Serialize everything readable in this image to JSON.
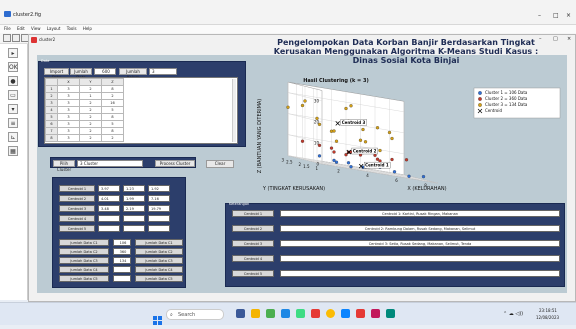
{
  "outer_window": {
    "title": "cluster2.fig"
  },
  "menu": [
    "File",
    "Edit",
    "View",
    "Layout",
    "Tools",
    "Help"
  ],
  "figure_window": {
    "title": "cluster2",
    "controls": [
      "–",
      "□",
      "×"
    ]
  },
  "data_panel": {
    "label": "Data",
    "import_button": "Import Data",
    "jumlah_data_label": "Jumlah Data",
    "jumlah_data_value": "600",
    "jumlah_kolom_label": "Jumlah Kolom",
    "jumlah_kolom_value": "3",
    "columns": [
      "X",
      "Y",
      "Z"
    ],
    "rows": [
      {
        "n": "1",
        "x": "3",
        "y": "2",
        "z": "8"
      },
      {
        "n": "2",
        "x": "3",
        "y": "1",
        "z": "2"
      },
      {
        "n": "3",
        "x": "3",
        "y": "2",
        "z": "16"
      },
      {
        "n": "4",
        "x": "3",
        "y": "2",
        "z": "5"
      },
      {
        "n": "5",
        "x": "3",
        "y": "2",
        "z": "8"
      },
      {
        "n": "6",
        "x": "3",
        "y": "2",
        "z": "5"
      },
      {
        "n": "7",
        "x": "3",
        "y": "2",
        "z": "8"
      },
      {
        "n": "8",
        "x": "3",
        "y": "2",
        "z": "2"
      }
    ]
  },
  "cluster_controls": {
    "pilih_label": "Pilih Cluster",
    "pilih_value": "3 Cluster",
    "process_button": "Process Cluster",
    "clear_button": "Clear"
  },
  "centroid_table": {
    "rows": [
      {
        "label": "Centroid 1",
        "v1": "3.97",
        "v2": "1.23",
        "v3": "1.92"
      },
      {
        "label": "Centroid 2",
        "v1": "4.01",
        "v2": "1.99",
        "v3": "7.16"
      },
      {
        "label": "Centroid 3",
        "v1": "3.48",
        "v2": "2.19",
        "v3": "19.79"
      },
      {
        "label": "Centroid 4",
        "v1": "",
        "v2": "",
        "v3": ""
      },
      {
        "label": "Centroid 5",
        "v1": "",
        "v2": "",
        "v3": ""
      }
    ]
  },
  "counts": {
    "rows": [
      {
        "left": "Jumlah Data C1",
        "value": "106",
        "right": "Jumlah Data C1"
      },
      {
        "left": "Jumlah Data C2",
        "value": "360",
        "right": "Jumlah Data C2"
      },
      {
        "left": "Jumlah Data C3",
        "value": "134",
        "right": "Jumlah Data C3"
      },
      {
        "left": "Jumlah Data C4",
        "value": "",
        "right": "Jumlah Data C4"
      },
      {
        "left": "Jumlah Data C5",
        "value": "",
        "right": "Jumlah Data C5"
      }
    ]
  },
  "header_title": "Pengelompokan Data Korban Banjir Berdasarkan Tingkat Kerusakan Menggunakan Algoritma K-Means Studi Kasus : Dinas Sosial Kota Binjai",
  "keterangan": {
    "label": "Keterangan",
    "rows": [
      {
        "label": "Centroid 1",
        "text": "Centroid 1: Kartini, Rusak Ringan, Makanan"
      },
      {
        "label": "Centroid 2",
        "text": "Centroid 2: Rambung Dalam, Rusak Sedang, Makanan, Selimut"
      },
      {
        "label": "Centroid 3",
        "text": "Centroid 3: Setia, Rusak Sedang, Makanan, Selimut, Tenda"
      },
      {
        "label": "Centroid 4",
        "text": ""
      },
      {
        "label": "Centroid 5",
        "text": ""
      }
    ]
  },
  "chart_data": {
    "type": "scatter",
    "title": "Hasil Clustering (k = 3)",
    "xlabel": "X (KELURAHAN)",
    "ylabel": "Y (TINGKAT KERUSAKAN)",
    "zlabel": "Z (BANTUAN YANG DITERIMA)",
    "xticks": [
      "2",
      "4",
      "6",
      "8"
    ],
    "yticks": [
      "1",
      "1.5",
      "2",
      "2.5",
      "3"
    ],
    "zticks": [
      "0",
      "10",
      "20",
      "30"
    ],
    "zlim": [
      0,
      35
    ],
    "grid": true,
    "legend_position": "top-right",
    "series": [
      {
        "name": "Cluster 1 = 106 Data",
        "color": "#2f6fd6",
        "points": [
          [
            2,
            1,
            2
          ],
          [
            3,
            1,
            1
          ],
          [
            4,
            1,
            2
          ],
          [
            5,
            1,
            3
          ],
          [
            6,
            1,
            2
          ],
          [
            7,
            1,
            1
          ],
          [
            3,
            2,
            2
          ],
          [
            5,
            2,
            1
          ],
          [
            8,
            1,
            2
          ],
          [
            2,
            2,
            3
          ],
          [
            4,
            2,
            2
          ],
          [
            6,
            2,
            3
          ]
        ]
      },
      {
        "name": "Cluster 2 = 360 Data",
        "color": "#c0392b",
        "points": [
          [
            2,
            2,
            8
          ],
          [
            3,
            2,
            6
          ],
          [
            4,
            2,
            7
          ],
          [
            5,
            2,
            8
          ],
          [
            6,
            2,
            6
          ],
          [
            7,
            2,
            7
          ],
          [
            3,
            1,
            8
          ],
          [
            5,
            1,
            6
          ],
          [
            8,
            2,
            8
          ],
          [
            4,
            3,
            7
          ],
          [
            6,
            3,
            6
          ],
          [
            2,
            3,
            8
          ],
          [
            7,
            3,
            7
          ],
          [
            5,
            3,
            5
          ]
        ]
      },
      {
        "name": "Cluster 3 = 134 Data",
        "color": "#d4a017",
        "points": [
          [
            2,
            2,
            18
          ],
          [
            2,
            3,
            25
          ],
          [
            3,
            2,
            16
          ],
          [
            3,
            3,
            20
          ],
          [
            4,
            2,
            22
          ],
          [
            4,
            3,
            15
          ],
          [
            5,
            2,
            19
          ],
          [
            5,
            3,
            27
          ],
          [
            6,
            2,
            21
          ],
          [
            2,
            1,
            12
          ],
          [
            3,
            1,
            30
          ],
          [
            6,
            3,
            13
          ],
          [
            7,
            2,
            17
          ],
          [
            1,
            3,
            23
          ],
          [
            1,
            2,
            28
          ],
          [
            4,
            1,
            14
          ],
          [
            8,
            3,
            19
          ],
          [
            5,
            1,
            11
          ]
        ]
      }
    ],
    "centroids": [
      {
        "label": "Centroid 1",
        "x": 3.97,
        "y": 1.23,
        "z": 1.92
      },
      {
        "label": "Centroid 2",
        "x": 4.01,
        "y": 1.99,
        "z": 7.16
      },
      {
        "label": "Centroid 3",
        "x": 3.48,
        "y": 2.19,
        "z": 19.79
      }
    ],
    "centroid_legend": "Centroid"
  },
  "taskbar": {
    "search_placeholder": "Search",
    "time": "23:18:51",
    "date": "12/08/2023"
  }
}
